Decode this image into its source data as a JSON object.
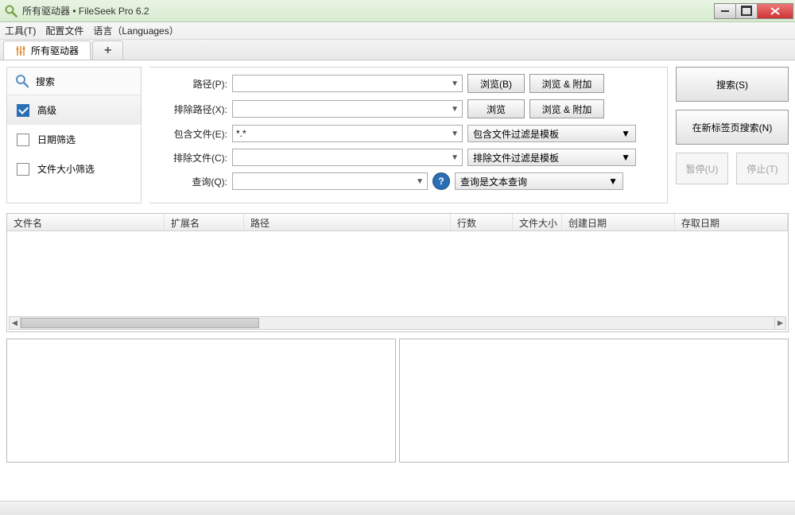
{
  "window": {
    "title": "所有驱动器 • FileSeek Pro 6.2"
  },
  "menu": {
    "tools": "工具(T)",
    "profiles": "配置文件",
    "languages": "语言（Languages）"
  },
  "tabs": {
    "main": "所有驱动器",
    "plus": "+"
  },
  "nav": {
    "search_header": "搜索",
    "items": [
      {
        "label": "高级",
        "checked": true
      },
      {
        "label": "日期筛选",
        "checked": false
      },
      {
        "label": "文件大小筛选",
        "checked": false
      }
    ]
  },
  "form": {
    "path_label": "路径(P):",
    "exclude_path_label": "排除路径(X):",
    "include_files_label": "包含文件(E):",
    "include_files_value": "*.*",
    "exclude_files_label": "排除文件(C):",
    "query_label": "查询(Q):",
    "browse_b": "浏览(B)",
    "browse": "浏览",
    "browse_append": "浏览 & 附加",
    "include_template": "包含文件过滤是模板",
    "exclude_template": "排除文件过滤是模板",
    "query_mode": "查询是文本查询",
    "help": "?"
  },
  "actions": {
    "search": "搜索(S)",
    "search_new_tab": "在新标签页搜索(N)",
    "pause": "暂停(U)",
    "stop": "停止(T)"
  },
  "columns": {
    "filename": "文件名",
    "ext": "扩展名",
    "path": "路径",
    "lines": "行数",
    "size": "文件大小",
    "created": "创建日期",
    "accessed": "存取日期"
  }
}
